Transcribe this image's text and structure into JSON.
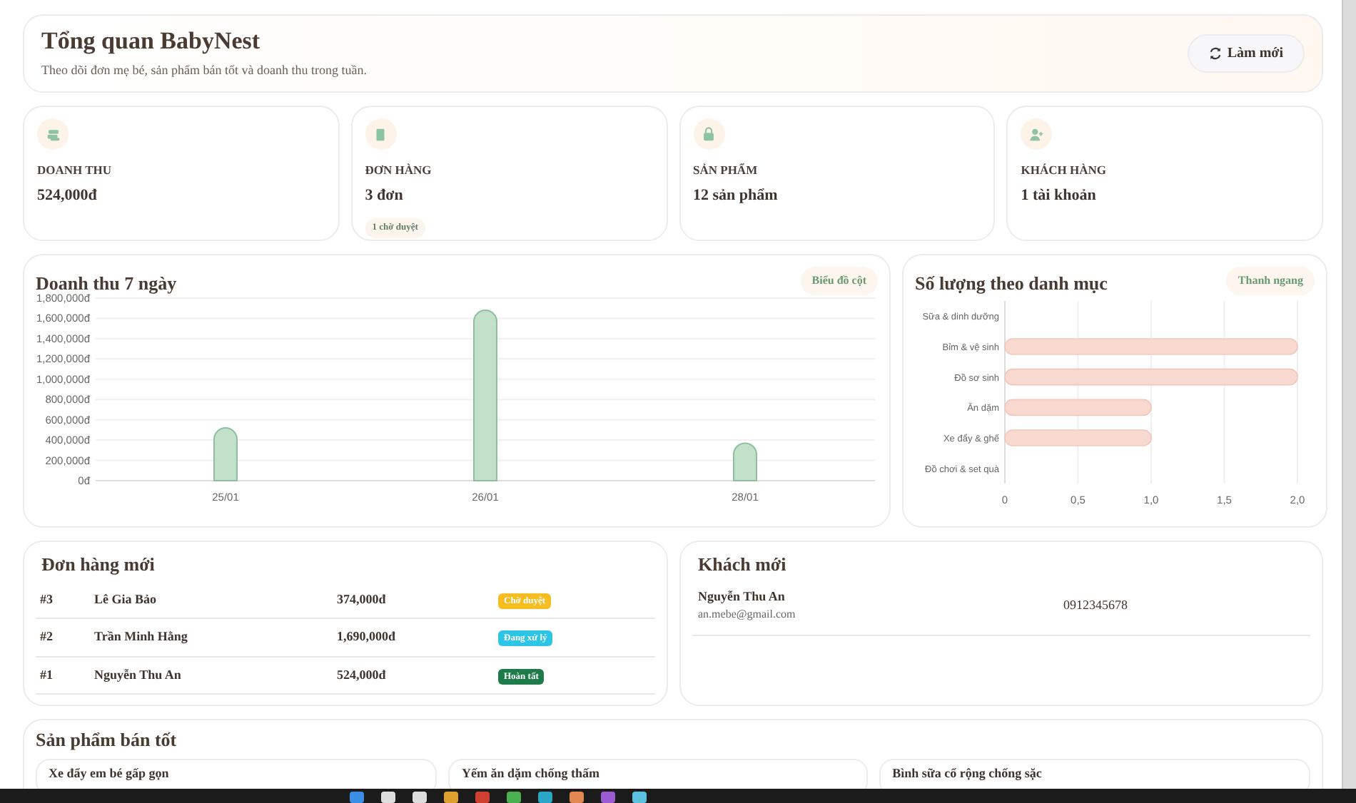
{
  "header": {
    "title": "Tổng quan BabyNest",
    "subtitle": "Theo dõi đơn mẹ bé, sản phẩm bán tốt và doanh thu trong tuần.",
    "refresh_button": "Làm mới"
  },
  "stats": [
    {
      "kind": "revenue",
      "label": "DOANH THU",
      "value": "524,000đ"
    },
    {
      "kind": "orders",
      "label": "ĐƠN HÀNG",
      "value": "3 đơn",
      "note": "1 chờ duyệt"
    },
    {
      "kind": "products",
      "label": "SẢN PHẨM",
      "value": "12 sản phẩm"
    },
    {
      "kind": "customers",
      "label": "KHÁCH HÀNG",
      "value": "1 tài khoản"
    }
  ],
  "revenue_chart": {
    "title": "Doanh thu 7 ngày",
    "badge": "Biểu đồ cột",
    "chart_data": {
      "type": "bar",
      "categories": [
        "25/01",
        "26/01",
        "28/01"
      ],
      "grid": true,
      "series": [
        {
          "color": "#c3e0cb",
          "values": [
            520000,
            1680000,
            370000
          ]
        }
      ],
      "ylim": [
        0,
        1800000
      ],
      "yticks": [
        {
          "value": 0,
          "label": "0đ"
        },
        {
          "value": 200000,
          "label": "200,000đ"
        },
        {
          "value": 400000,
          "label": "400,000đ"
        },
        {
          "value": 600000,
          "label": "600,000đ"
        },
        {
          "value": 800000,
          "label": "800,000đ"
        },
        {
          "value": 1000000,
          "label": "1,000,000đ"
        },
        {
          "value": 1200000,
          "label": "1,200,000đ"
        },
        {
          "value": 1400000,
          "label": "1,400,000đ"
        },
        {
          "value": 1600000,
          "label": "1,600,000đ"
        },
        {
          "value": 1800000,
          "label": "1,800,000đ"
        }
      ]
    }
  },
  "category_chart": {
    "title": "Số lượng theo danh mục",
    "badge": "Thanh ngang",
    "chart_data": {
      "type": "bar",
      "orientation": "horizontal",
      "categories": [
        "Sữa & dinh dưỡng",
        "Bỉm & vệ sinh",
        "Đồ sơ sinh",
        "Ăn dặm",
        "Xe đẩy & ghế",
        "Đồ chơi & set quà"
      ],
      "grid": true,
      "series": [
        {
          "color": "#f8d9d0",
          "values": [
            0,
            2,
            2,
            1,
            1,
            0
          ]
        }
      ],
      "xlim": [
        0,
        2
      ],
      "xticks": [
        {
          "value": 0,
          "label": "0"
        },
        {
          "value": 0.5,
          "label": "0,5"
        },
        {
          "value": 1,
          "label": "1,0"
        },
        {
          "value": 1.5,
          "label": "1,5"
        },
        {
          "value": 2,
          "label": "2,0"
        }
      ]
    }
  },
  "orders": {
    "title": "Đơn hàng mới",
    "rows": [
      {
        "id": "#3",
        "customer": "Lê Gia Bảo",
        "total": "374,000đ",
        "status": "Chờ duyệt",
        "color": "#f5bd1f"
      },
      {
        "id": "#2",
        "customer": "Trần Minh Hằng",
        "total": "1,690,000đ",
        "status": "Đang xử lý",
        "color": "#2ec4e6"
      },
      {
        "id": "#1",
        "customer": "Nguyễn Thu An",
        "total": "524,000đ",
        "status": "Hoàn tất",
        "color": "#1f7a4a"
      }
    ]
  },
  "customers": {
    "title": "Khách mới",
    "rows": [
      {
        "name": "Nguyễn Thu An",
        "email": "an.mebe@gmail.com",
        "phone": "0912345678"
      }
    ]
  },
  "best_sellers": {
    "title": "Sản phẩm bán tốt",
    "products": [
      {
        "name": "Xe đẩy em bé gấp gọn"
      },
      {
        "name": "Yếm ăn dặm chống thấm"
      },
      {
        "name": "Bình sữa cổ rộng chống sặc"
      }
    ]
  }
}
